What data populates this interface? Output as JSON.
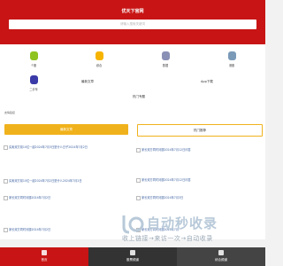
{
  "header": {
    "title": "优天下官网",
    "search_placeholder": "请输入搜索关键词"
  },
  "categories": [
    {
      "label": "个股",
      "color": "#8fc31f"
    },
    {
      "label": "综合",
      "color": "#f6b400"
    },
    {
      "label": "数据",
      "color": "#8a8fb5"
    },
    {
      "label": "港股",
      "color": "#7a9ab8"
    },
    {
      "label": "二手车",
      "color": "#3a3aa8"
    }
  ],
  "links": {
    "primary": "最新文章",
    "secondary": "App下载",
    "tertiary": "热门专题"
  },
  "tag": "友情链接",
  "tabs": {
    "active": "最新文章",
    "inactive": "热门推荐"
  },
  "left_items": [
    "买卖双方前10位一起2024年7月3日是什么日子2024年7月2日",
    "买卖双方前10位一起2024年7月2日是什么2024年7月2日",
    "家长双方同时问题2024年7月2日",
    "家长双方同时问题2024年7月2日"
  ],
  "right_items": [
    "家长双方同时问题2024年7月12日问答",
    "家长双方同时问题2024年7月12日问答",
    "家长双方同时问题2024年7月3日",
    "家长双方同时问题2024年7月"
  ],
  "bottom_nav": [
    "首页",
    "股票频道",
    "综合频道"
  ],
  "watermark": {
    "brand": "自动秒收录",
    "slogan": "收上链接→来访一次→自动收录"
  }
}
